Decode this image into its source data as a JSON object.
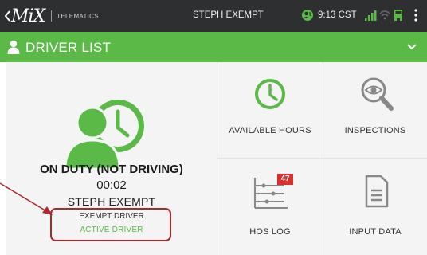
{
  "topbar": {
    "brand_logo": "MiX",
    "brand_sub": "TELEMATICS",
    "user_name": "STEPH EXEMPT",
    "time": "9:13 CST"
  },
  "header": {
    "title": "DRIVER LIST"
  },
  "driver_panel": {
    "status": "ON DUTY (NOT DRIVING)",
    "elapsed": "00:02",
    "name": "STEPH EXEMPT",
    "exempt_label": "EXEMPT DRIVER",
    "active_label": "ACTIVE DRIVER"
  },
  "tiles": [
    {
      "label": "AVAILABLE HOURS",
      "icon": "clock-icon"
    },
    {
      "label": "INSPECTIONS",
      "icon": "magnifier-eye-icon"
    },
    {
      "label": "HOS LOG",
      "icon": "hos-log-icon",
      "badge": "47"
    },
    {
      "label": "INPUT DATA",
      "icon": "document-icon"
    }
  ],
  "colors": {
    "green": "#5ab947",
    "topbar": "#2d2f30",
    "highlight": "#b0272d",
    "badge": "#e02b2b"
  }
}
